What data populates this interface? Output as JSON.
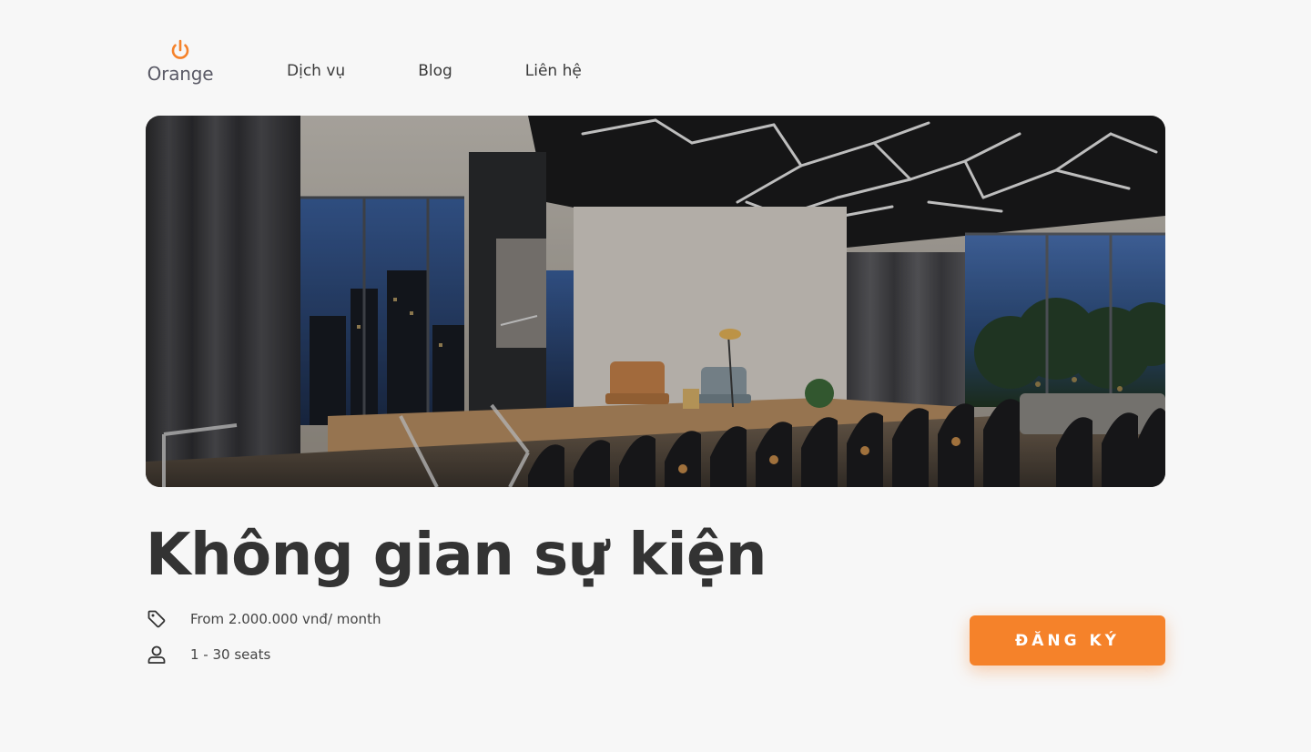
{
  "brand": {
    "name": "Orange",
    "accent_color": "#f5822a",
    "icon": "power-icon"
  },
  "nav": {
    "items": [
      {
        "label": "Dịch vụ"
      },
      {
        "label": "Blog"
      },
      {
        "label": "Liên hệ"
      }
    ]
  },
  "hero": {
    "image": "event-space-photo"
  },
  "listing": {
    "title": "Không gian sự kiện",
    "price": "From 2.000.000 vnđ/ month",
    "price_icon": "tag-icon",
    "seats": "1 - 30 seats",
    "seats_icon": "user-icon"
  },
  "cta": {
    "label": "ĐĂNG KÝ",
    "color": "#f5822a"
  }
}
